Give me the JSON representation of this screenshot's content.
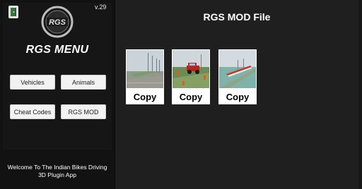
{
  "app": {
    "version": "v.29",
    "logo_text": "RGS",
    "exit_icon": "exit-door-icon"
  },
  "sidebar": {
    "title": "RGS MENU",
    "buttons": [
      "Vehicles",
      "Animals",
      "Cheat Codes",
      "RGS MOD"
    ],
    "welcome_text": "Welcome To The Indian Bikes Driving 3D Plugin App"
  },
  "main": {
    "title": "RGS MOD File",
    "cards": [
      {
        "thumbnail": "road-scene-thumbnail",
        "copy_label": "Copy"
      },
      {
        "thumbnail": "red-jeep-scene-thumbnail",
        "copy_label": "Copy"
      },
      {
        "thumbnail": "water-ramp-scene-thumbnail",
        "copy_label": "Copy"
      }
    ]
  },
  "colors": {
    "background": "#1f1f1f",
    "sidebar": "#121212",
    "button": "#f2f2f2",
    "text": "#ffffff"
  }
}
